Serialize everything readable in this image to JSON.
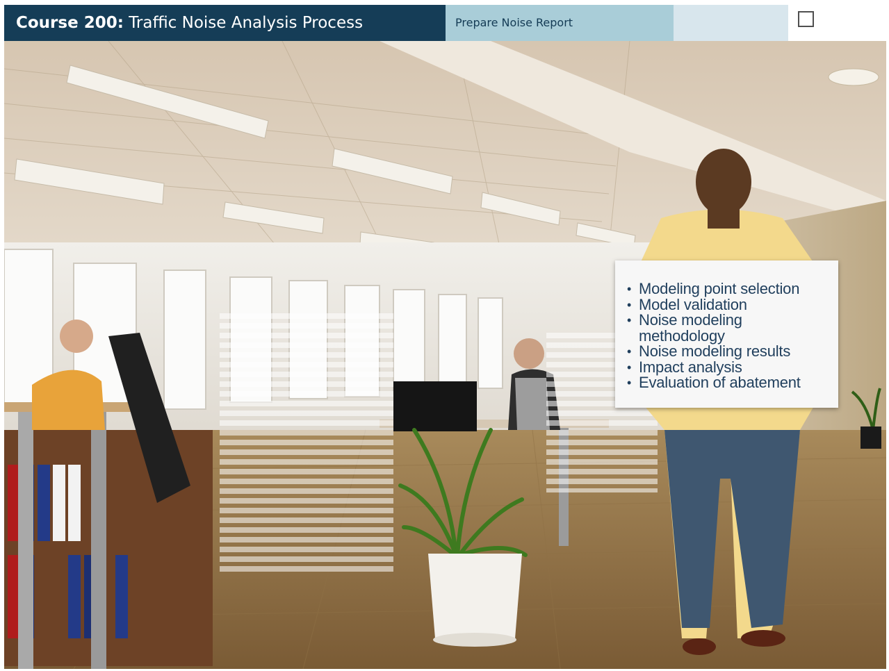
{
  "header": {
    "course_label": "Course 200:",
    "course_title": "Traffic Noise Analysis Process",
    "section_tab": "Prepare Noise Report"
  },
  "sign": {
    "items": [
      "Modeling point selection",
      "Model validation",
      "Noise modeling methodology",
      "Noise modeling results",
      "Impact analysis",
      "Evaluation of abatement"
    ]
  },
  "colors": {
    "header_bg": "#153d57",
    "section_tab_bg": "#a9cdd8",
    "blank_tab_bg": "#d8e6ed",
    "sign_text": "#1f3e5c"
  }
}
